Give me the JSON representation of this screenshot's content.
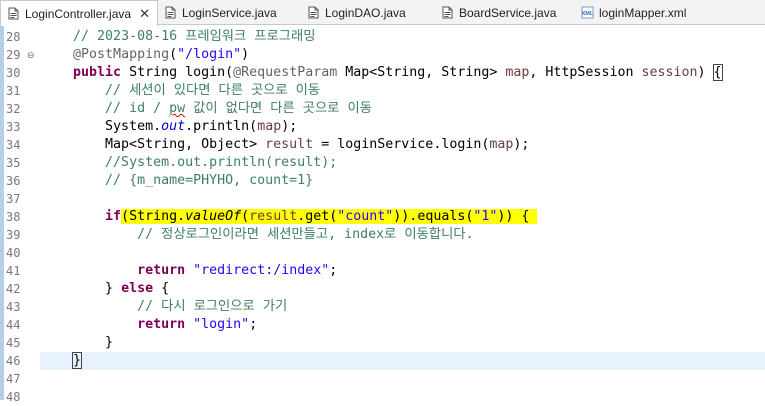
{
  "tabs": [
    {
      "label": "LoginController.java",
      "close": "✕",
      "active": true,
      "icon": "java-file-icon"
    },
    {
      "label": "LoginService.java",
      "active": false,
      "icon": "java-file-icon"
    },
    {
      "label": "LoginDAO.java",
      "active": false,
      "icon": "java-file-icon"
    },
    {
      "label": "BoardService.java",
      "active": false,
      "icon": "java-file-icon"
    },
    {
      "label": "loginMapper.xml",
      "active": false,
      "icon": "xml-file-icon",
      "icon_text": "XML"
    }
  ],
  "fold_marker": "⊖",
  "code_lines": [
    {
      "num": "28",
      "parts": [
        {
          "t": "    ",
          "c": ""
        },
        {
          "t": "// 2023-08-16 프레임워크 프로그래밍",
          "c": "cm"
        }
      ]
    },
    {
      "num": "29",
      "fold": true,
      "parts": [
        {
          "t": "    ",
          "c": ""
        },
        {
          "t": "@PostMapping",
          "c": "ann"
        },
        {
          "t": "(",
          "c": ""
        },
        {
          "t": "\"/login\"",
          "c": "str"
        },
        {
          "t": ")",
          "c": ""
        }
      ]
    },
    {
      "num": "30",
      "parts": [
        {
          "t": "    ",
          "c": ""
        },
        {
          "t": "public",
          "c": "kw"
        },
        {
          "t": " String login(",
          "c": ""
        },
        {
          "t": "@RequestParam",
          "c": "ann"
        },
        {
          "t": " Map<String, String> ",
          "c": ""
        },
        {
          "t": "map",
          "c": "var"
        },
        {
          "t": ", HttpSession ",
          "c": ""
        },
        {
          "t": "session",
          "c": "var"
        },
        {
          "t": ") ",
          "c": ""
        },
        {
          "t": "{",
          "c": "bracket"
        }
      ]
    },
    {
      "num": "31",
      "parts": [
        {
          "t": "        ",
          "c": ""
        },
        {
          "t": "// 세션이 있다면 다른 곳으로 이동",
          "c": "cm"
        }
      ]
    },
    {
      "num": "32",
      "parts": [
        {
          "t": "        ",
          "c": ""
        },
        {
          "t": "// id / ",
          "c": "cm"
        },
        {
          "t": "pw",
          "c": "cm squig"
        },
        {
          "t": " 값이 없다면 다른 곳으로 이동",
          "c": "cm"
        }
      ]
    },
    {
      "num": "33",
      "parts": [
        {
          "t": "        System.",
          "c": ""
        },
        {
          "t": "out",
          "c": "fld"
        },
        {
          "t": ".println(",
          "c": ""
        },
        {
          "t": "map",
          "c": "var"
        },
        {
          "t": ");",
          "c": ""
        }
      ]
    },
    {
      "num": "34",
      "parts": [
        {
          "t": "        Map<String, Object> ",
          "c": ""
        },
        {
          "t": "result",
          "c": "var"
        },
        {
          "t": " = ",
          "c": ""
        },
        {
          "t": "loginService",
          "c": "fld-plain"
        },
        {
          "t": ".login(",
          "c": ""
        },
        {
          "t": "map",
          "c": "var"
        },
        {
          "t": ");",
          "c": ""
        }
      ]
    },
    {
      "num": "35",
      "parts": [
        {
          "t": "        ",
          "c": ""
        },
        {
          "t": "//System.out.println(result);",
          "c": "cm"
        }
      ]
    },
    {
      "num": "36",
      "parts": [
        {
          "t": "        ",
          "c": ""
        },
        {
          "t": "// {m_name=PHYHO, count=1}",
          "c": "cm"
        }
      ]
    },
    {
      "num": "37",
      "parts": []
    },
    {
      "num": "38",
      "parts": [
        {
          "t": "        ",
          "c": ""
        },
        {
          "t": "if",
          "c": "kw"
        },
        {
          "t": "(String.",
          "c": "hl"
        },
        {
          "t": "valueOf",
          "c": "hl smeth"
        },
        {
          "t": "(",
          "c": "hl"
        },
        {
          "t": "result",
          "c": "hl var"
        },
        {
          "t": ".get(",
          "c": "hl"
        },
        {
          "t": "\"count\"",
          "c": "hl str"
        },
        {
          "t": ")).equals(",
          "c": "hl"
        },
        {
          "t": "\"1\"",
          "c": "hl str"
        },
        {
          "t": ")) {",
          "c": "hl"
        },
        {
          "t": " ",
          "c": "hl"
        }
      ]
    },
    {
      "num": "39",
      "parts": [
        {
          "t": "            ",
          "c": ""
        },
        {
          "t": "// 정상로그인이라면 세션만들고, index로 이동합니다.",
          "c": "cm"
        }
      ]
    },
    {
      "num": "40",
      "parts": []
    },
    {
      "num": "41",
      "parts": [
        {
          "t": "            ",
          "c": ""
        },
        {
          "t": "return",
          "c": "kw"
        },
        {
          "t": " ",
          "c": ""
        },
        {
          "t": "\"redirect:/index\"",
          "c": "str"
        },
        {
          "t": ";",
          "c": ""
        }
      ]
    },
    {
      "num": "42",
      "parts": [
        {
          "t": "        } ",
          "c": ""
        },
        {
          "t": "else",
          "c": "kw"
        },
        {
          "t": " {",
          "c": ""
        }
      ]
    },
    {
      "num": "43",
      "parts": [
        {
          "t": "            ",
          "c": ""
        },
        {
          "t": "// 다시 로그인으로 가기",
          "c": "cm"
        }
      ]
    },
    {
      "num": "44",
      "parts": [
        {
          "t": "            ",
          "c": ""
        },
        {
          "t": "return",
          "c": "kw"
        },
        {
          "t": " ",
          "c": ""
        },
        {
          "t": "\"login\"",
          "c": "str"
        },
        {
          "t": ";",
          "c": ""
        }
      ]
    },
    {
      "num": "45",
      "parts": [
        {
          "t": "        }",
          "c": ""
        }
      ]
    },
    {
      "num": "46",
      "current": true,
      "caret": true,
      "parts": [
        {
          "t": "    ",
          "c": ""
        },
        {
          "t": "}",
          "c": "bracket"
        }
      ]
    },
    {
      "num": "47",
      "parts": []
    },
    {
      "num": "48",
      "parts": []
    }
  ],
  "colors": {
    "comment": "#3f7f5f",
    "keyword": "#7f0055",
    "string": "#2a00ff",
    "annotation": "#646464",
    "field": "#0000c0",
    "local_variable": "#6a3e3e",
    "highlight": "#ffff00",
    "current_line": "#e8f2fe"
  }
}
